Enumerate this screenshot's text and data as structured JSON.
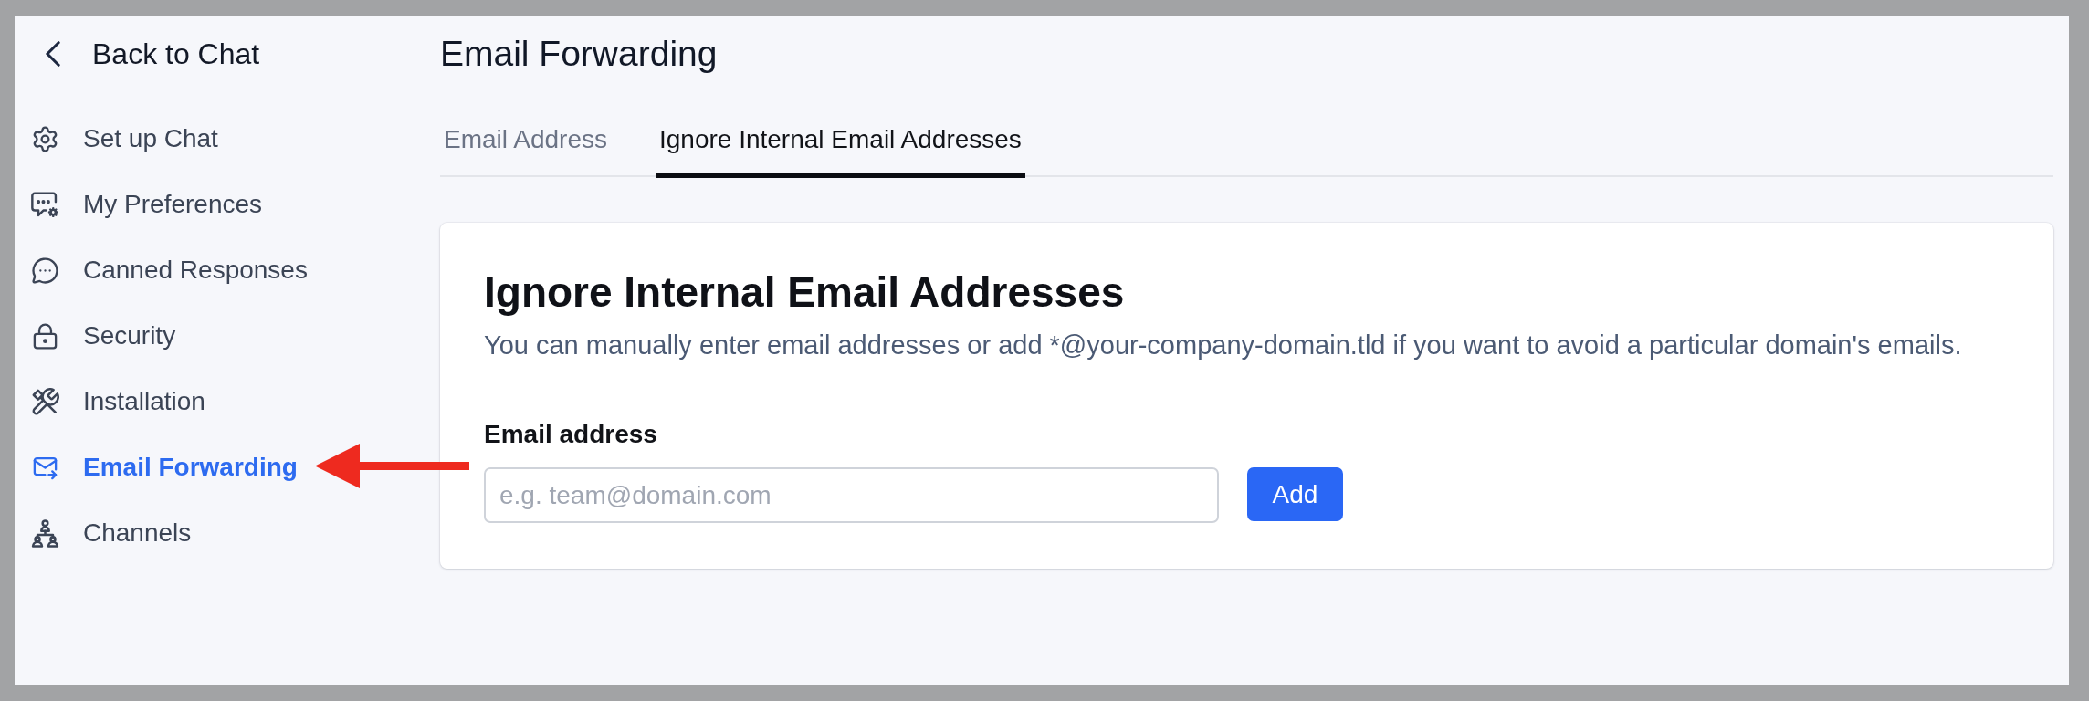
{
  "back_link": {
    "label": "Back to Chat"
  },
  "sidebar": {
    "items": [
      {
        "label": "Set up Chat",
        "selected": false
      },
      {
        "label": "My Preferences",
        "selected": false
      },
      {
        "label": "Canned Responses",
        "selected": false
      },
      {
        "label": "Security",
        "selected": false
      },
      {
        "label": "Installation",
        "selected": false
      },
      {
        "label": "Email Forwarding",
        "selected": true
      },
      {
        "label": "Channels",
        "selected": false
      }
    ]
  },
  "page": {
    "title": "Email Forwarding"
  },
  "tabs": [
    {
      "label": "Email Address",
      "selected": false
    },
    {
      "label": "Ignore Internal Email Addresses",
      "selected": true
    }
  ],
  "card": {
    "heading": "Ignore Internal Email Addresses",
    "description": "You can manually enter email addresses or add *@your-company-domain.tld if you want to avoid a particular domain's emails.",
    "field": {
      "label": "Email address",
      "placeholder": "e.g. team@domain.com"
    },
    "button": "Add"
  }
}
